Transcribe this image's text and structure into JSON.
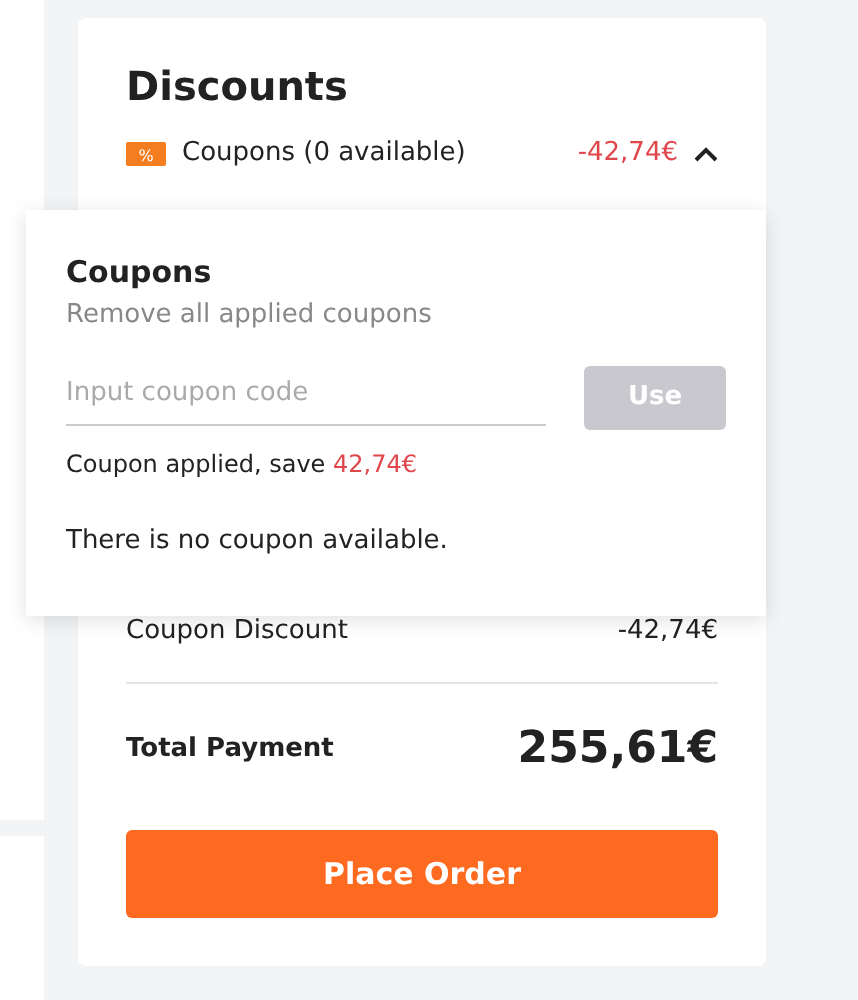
{
  "discounts": {
    "title": "Discounts",
    "coupon_row": {
      "badge": "%",
      "label": "Coupons (0 available)",
      "amount": "-42,74€",
      "expanded": true
    },
    "popover": {
      "title": "Coupons",
      "remove_link": "Remove all applied coupons",
      "input": {
        "placeholder": "Input coupon code"
      },
      "use_button": {
        "label": "Use",
        "disabled": true
      },
      "applied_text": "Coupon applied, save ",
      "applied_amount": "42,74€",
      "empty_message": "There is no coupon available."
    },
    "rows": [
      {
        "label": "Coupon Discount",
        "value": "-42,74€"
      }
    ],
    "total": {
      "label": "Total Payment",
      "value": "255,61€"
    },
    "order_button": "Place Order"
  }
}
